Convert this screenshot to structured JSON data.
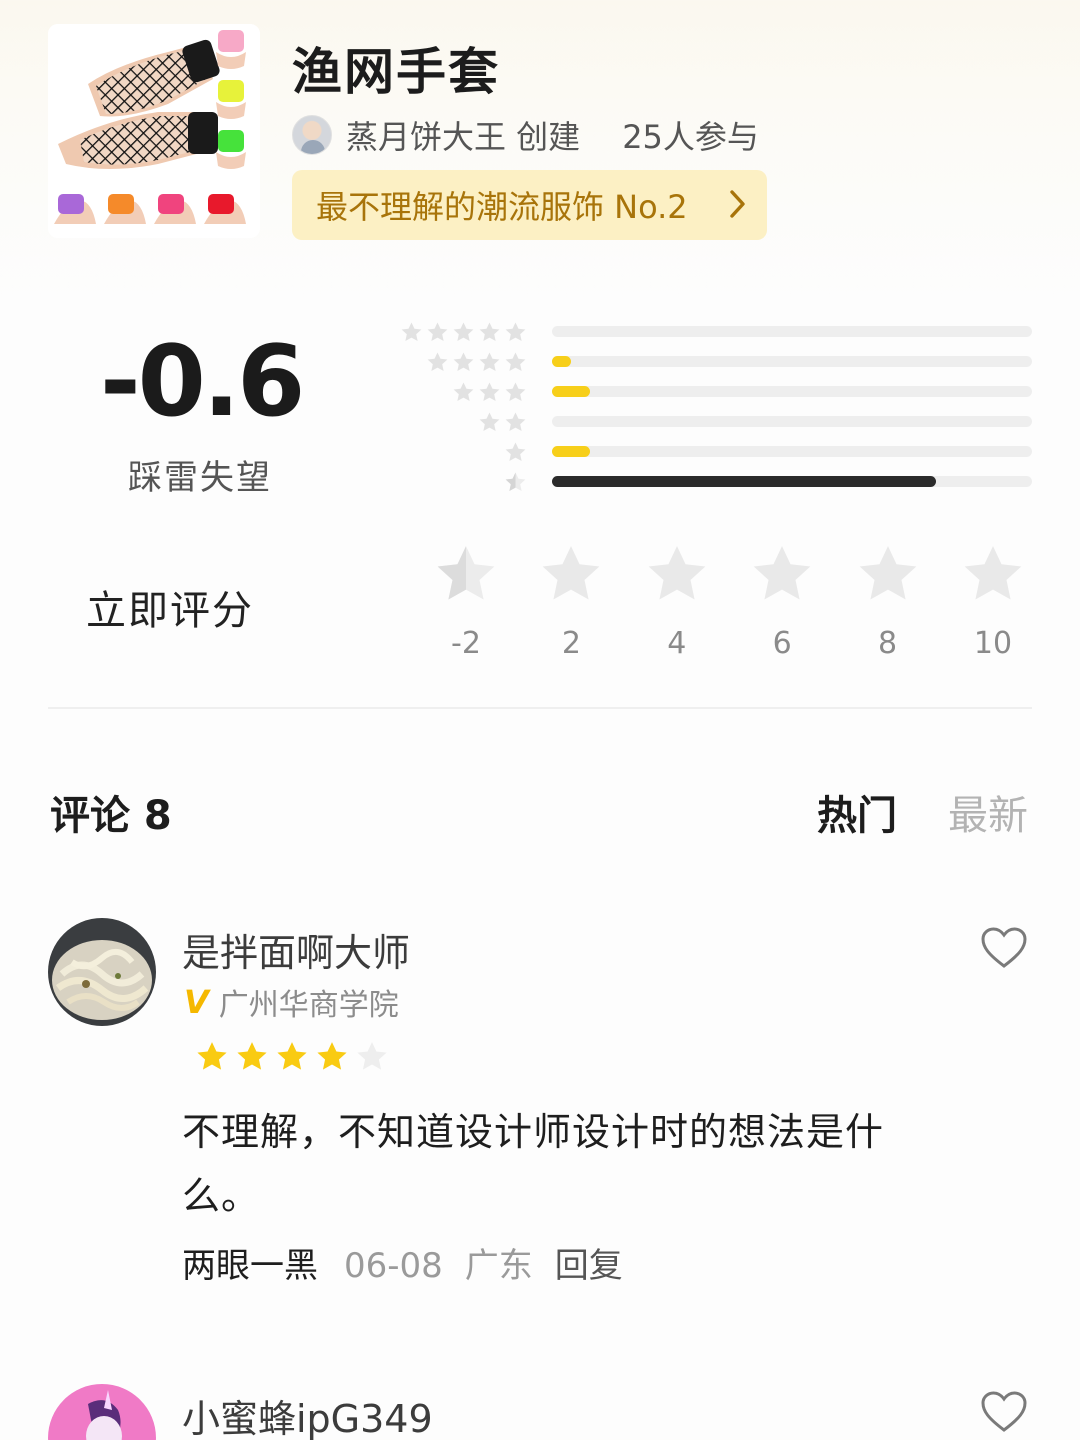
{
  "item": {
    "title": "渔网手套",
    "creator": "蒸月饼大王 创建",
    "participants": "25人参与",
    "rank_badge": "最不理解的潮流服饰 No.2"
  },
  "score": {
    "value": "-0.6",
    "label": "踩雷失望",
    "distribution": [
      {
        "stars": 5,
        "fraction": 0.0
      },
      {
        "stars": 4,
        "fraction": 0.04
      },
      {
        "stars": 3,
        "fraction": 0.08
      },
      {
        "stars": 2,
        "fraction": 0.0
      },
      {
        "stars": 1,
        "fraction": 0.08
      },
      {
        "stars": 0.5,
        "fraction": 0.8
      }
    ],
    "colors": {
      "highlight": "#f7cf1a",
      "dominant": "#2b2b2b",
      "track": "#eeeeee"
    }
  },
  "rate_now": {
    "label": "立即评分",
    "options": [
      "-2",
      "2",
      "4",
      "6",
      "8",
      "10"
    ]
  },
  "comments_header": {
    "title": "评论 8",
    "tab_hot": "热门",
    "tab_new": "最新"
  },
  "comments": [
    {
      "user": "是拌面啊大师",
      "verified_badge": "V",
      "school": "广州华商学院",
      "rating_stars": 4,
      "text": "不理解，不知道设计师设计时的想法是什么。",
      "tag": "两眼一黑",
      "date": "06-08",
      "location": "广东",
      "reply": "回复"
    },
    {
      "user": "小蜜蜂ipG349"
    }
  ]
}
